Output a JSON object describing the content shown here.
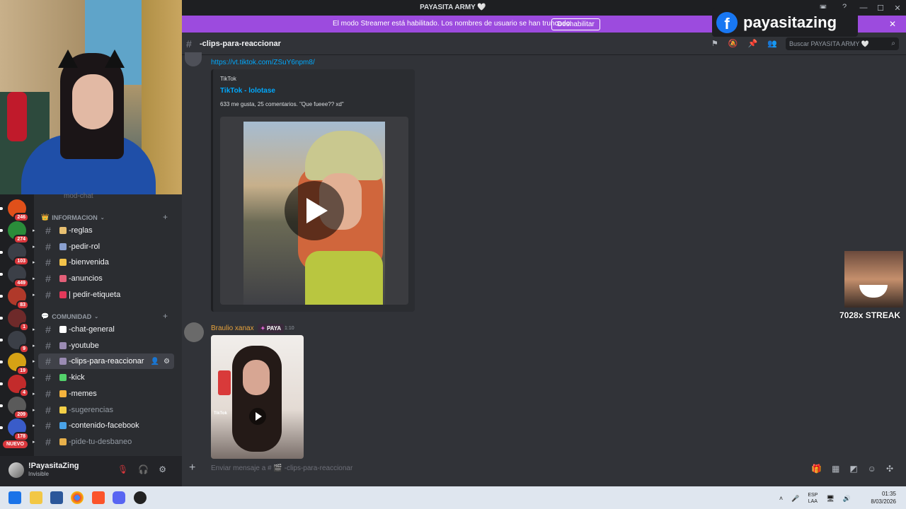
{
  "window": {
    "title": "PAYASITA ARMY 🤍"
  },
  "banner": {
    "message": "El modo Streamer está habilitado. Los nombres de usuario se han truncado.",
    "disable_label": "Deshabilitar"
  },
  "overlay": {
    "facebook_name": "payasitazing",
    "streak_text": "7028x STREAK"
  },
  "servers": [
    {
      "badge": "246",
      "color": "#e0501a"
    },
    {
      "badge": "274",
      "color": "#2a8c3a"
    },
    {
      "badge": "103",
      "color": "#3b3f47"
    },
    {
      "badge": "449",
      "color": "#3b3f47"
    },
    {
      "badge": "83",
      "color": "#b0392a"
    },
    {
      "badge": "1",
      "color": "#6e2a2a"
    },
    {
      "badge": "9",
      "color": "#3b3f47"
    },
    {
      "badge": "19",
      "color": "#d6a215"
    },
    {
      "badge": "4",
      "color": "#c32b2b"
    },
    {
      "badge": "209",
      "color": "#5a5a5a"
    },
    {
      "badge": "178",
      "color": "#3a5cc9"
    }
  ],
  "nuevo_label": "NUEVO",
  "sidebar": {
    "partial_top": "mod-chat",
    "categories": [
      {
        "label": "INFORMACION"
      },
      {
        "label": "COMUNIDAD"
      }
    ],
    "info_channels": [
      {
        "label": "-reglas",
        "emoji_color": "#e8c071"
      },
      {
        "label": "-pedir-rol",
        "emoji_color": "#8aa0d0"
      },
      {
        "label": "-bienvenida",
        "emoji_color": "#f3c34a"
      },
      {
        "label": "-anuncios",
        "emoji_color": "#e35f78"
      },
      {
        "label": "| pedir-etiqueta",
        "emoji_color": "#e2395a"
      }
    ],
    "community_channels": [
      {
        "label": "-chat-general",
        "emoji_color": "#ffffff",
        "dim": false
      },
      {
        "label": "-youtube",
        "emoji_color": "#9a8bb3",
        "dim": false
      },
      {
        "label": "-clips-para-reaccionar",
        "emoji_color": "#9a8bb3",
        "dim": false
      },
      {
        "label": "-kick",
        "emoji_color": "#53d26b",
        "dim": false
      },
      {
        "label": "-memes",
        "emoji_color": "#f5b33d",
        "dim": false
      },
      {
        "label": "-sugerencias",
        "emoji_color": "#f4d047",
        "dim": true
      },
      {
        "label": "-contenido-facebook",
        "emoji_color": "#4aa3e8",
        "dim": false
      },
      {
        "label": "-pide-tu-desbaneo",
        "emoji_color": "#e7b04b",
        "dim": true
      }
    ]
  },
  "user": {
    "name": "!PayasitaZing",
    "status": "Invisible"
  },
  "channel": {
    "name": "-clips-para-reaccionar"
  },
  "search": {
    "placeholder": "Buscar PAYASITA ARMY 🤍"
  },
  "messages": {
    "first": {
      "link": "https://vt.tiktok.com/ZSuY6npm8/",
      "embed": {
        "provider": "TikTok",
        "title": "TikTok - lolotase",
        "description": "633 me gusta, 25 comentarios. \"Que fueee?? xd\""
      }
    },
    "second": {
      "author": "Braulio xanax",
      "role": "PAYA",
      "time": "1:10",
      "thumb_label": "TikTok"
    }
  },
  "composer": {
    "placeholder": "Enviar mensaje a # 🎬 -clips-para-reaccionar"
  },
  "tray": {
    "lang1": "ESP",
    "lang2": "LAA",
    "time": "01:35",
    "date": "8/03/2026"
  }
}
